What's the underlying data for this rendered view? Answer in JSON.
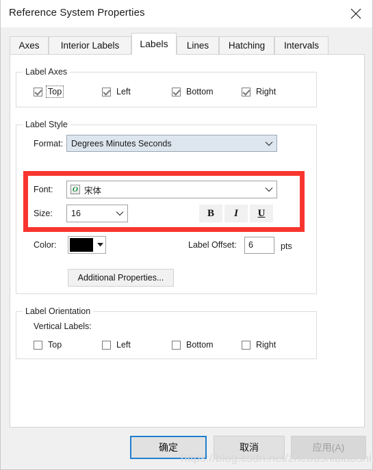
{
  "window": {
    "title": "Reference System Properties",
    "close_icon": "close-icon"
  },
  "tabs": [
    {
      "label": "Axes",
      "active": false
    },
    {
      "label": "Interior Labels",
      "active": false
    },
    {
      "label": "Labels",
      "active": true
    },
    {
      "label": "Lines",
      "active": false
    },
    {
      "label": "Hatching",
      "active": false
    },
    {
      "label": "Intervals",
      "active": false
    }
  ],
  "label_axes": {
    "title": "Label Axes",
    "items": [
      {
        "label": "Top",
        "checked": true,
        "focused": true
      },
      {
        "label": "Left",
        "checked": true,
        "focused": false
      },
      {
        "label": "Bottom",
        "checked": true,
        "focused": false
      },
      {
        "label": "Right",
        "checked": true,
        "focused": false
      }
    ]
  },
  "label_style": {
    "title": "Label Style",
    "format_label": "Format:",
    "format_value": "Degrees Minutes Seconds",
    "font_label": "Font:",
    "font_value": "宋体",
    "font_icon": "opentype-font-icon",
    "size_label": "Size:",
    "size_value": "16",
    "bold_label": "B",
    "italic_label": "I",
    "underline_label": "U",
    "color_label": "Color:",
    "color_value": "#000000",
    "offset_label": "Label Offset:",
    "offset_value": "6",
    "offset_units": "pts",
    "additional_properties_label": "Additional Properties..."
  },
  "label_orientation": {
    "title": "Label Orientation",
    "vertical_labels_label": "Vertical Labels:",
    "items": [
      {
        "label": "Top",
        "checked": false
      },
      {
        "label": "Left",
        "checked": false
      },
      {
        "label": "Bottom",
        "checked": false
      },
      {
        "label": "Right",
        "checked": false
      }
    ]
  },
  "footer": {
    "ok_label": "确定",
    "cancel_label": "取消",
    "apply_label": "应用(A)"
  },
  "watermark": "https://blog.csdn.net/zhebushibiaoshifu",
  "colors": {
    "accent": "#1f7fd0",
    "annotation": "#f8362f",
    "combo_tint": "#dde6ef"
  }
}
